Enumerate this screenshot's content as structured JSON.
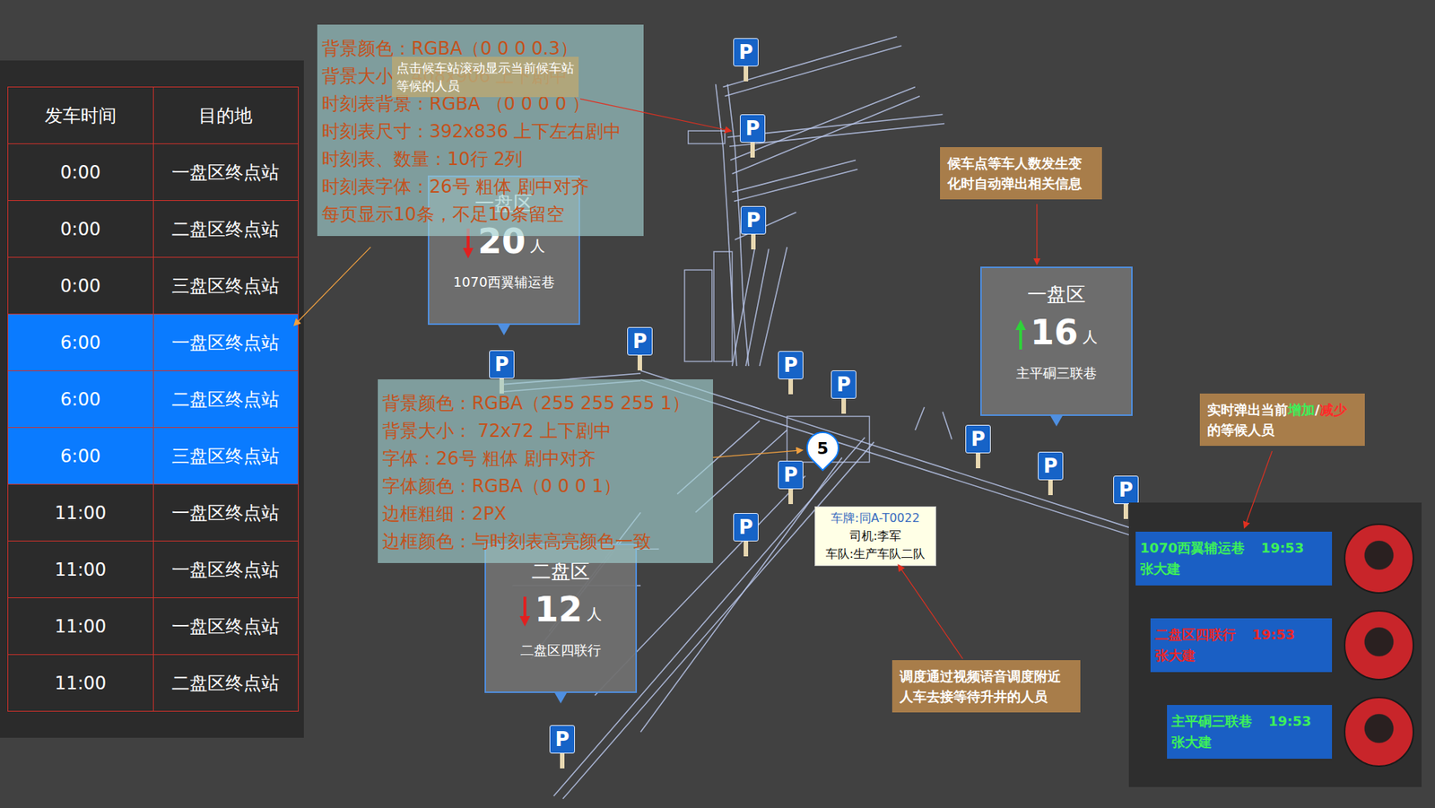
{
  "timetable": {
    "columns": [
      "发车时间",
      "目的地"
    ],
    "rows": [
      {
        "time": "0:00",
        "destination": "一盘区终点站",
        "selected": false
      },
      {
        "time": "0:00",
        "destination": "二盘区终点站",
        "selected": false
      },
      {
        "time": "0:00",
        "destination": "三盘区终点站",
        "selected": false
      },
      {
        "time": "6:00",
        "destination": "一盘区终点站",
        "selected": true
      },
      {
        "time": "6:00",
        "destination": "二盘区终点站",
        "selected": true
      },
      {
        "time": "6:00",
        "destination": "三盘区终点站",
        "selected": true
      },
      {
        "time": "11:00",
        "destination": "一盘区终点站",
        "selected": false
      },
      {
        "time": "11:00",
        "destination": "一盘区终点站",
        "selected": false
      },
      {
        "time": "11:00",
        "destination": "一盘区终点站",
        "selected": false
      },
      {
        "time": "11:00",
        "destination": "二盘区终点站",
        "selected": false
      }
    ]
  },
  "annotations": [
    {
      "lines": [
        "背景颜色：RGBA（0 0 0 0.3）",
        "背景大小：408x906 上下剧中",
        "时刻表背景：RGBA （0 0 0 0 ）",
        "时刻表尺寸：392x836 上下左右剧中",
        "时刻表、数量：10行 2列",
        "时刻表字体：26号 粗体 剧中对齐",
        "每页显示10条，不足10条留空"
      ]
    },
    {
      "lines": [
        "背景颜色：RGBA（255 255 255 1）",
        "背景大小： 72x72 上下剧中",
        "字体：26号 粗体 剧中对齐",
        "字体颜色：RGBA（0 0 0 1）",
        "边框粗细：2PX",
        "边框颜色：与时刻表高亮颜色一致"
      ]
    }
  ],
  "hint": "点击候车站滚动显示当前候车站等候的人员",
  "notes": [
    {
      "segments": [
        {
          "text": "候车点等车人数发生变化时自动弹出相关信息",
          "color": "#ffffff"
        }
      ]
    },
    {
      "segments": [
        {
          "text": "实时弹出当前",
          "color": "#ffffff"
        },
        {
          "text": "增加",
          "color": "#3cf05a"
        },
        {
          "text": "/",
          "color": "#ffffff"
        },
        {
          "text": "减少",
          "color": "#ff2a2a"
        },
        {
          "text": "的等候人员",
          "color": "#ffffff"
        }
      ]
    },
    {
      "segments": [
        {
          "text": "调度通过视频语音调度附近人车去接等待升井的人员",
          "color": "#ffffff"
        }
      ]
    }
  ],
  "stations": [
    {
      "area": "一盘区",
      "count": "20",
      "unit": "人",
      "place": "1070西翼辅运巷",
      "trend": "down",
      "color": "#e02020"
    },
    {
      "area": "一盘区",
      "count": "16",
      "unit": "人",
      "place": "主平硐三联巷",
      "trend": "up",
      "color": "#2fd13a"
    },
    {
      "area": "二盘区",
      "count": "12",
      "unit": "人",
      "place": "二盘区四联行",
      "trend": "down",
      "color": "#e02020"
    }
  ],
  "parking": [
    "P",
    "P",
    "P",
    "P",
    "P",
    "P",
    "P",
    "P",
    "P",
    "P",
    "P",
    "P",
    "P"
  ],
  "vehicle_marker": "5",
  "vehicle": {
    "lines": [
      "车牌:同A-T0022",
      "司机:李军",
      "车队:生产车队二队"
    ]
  },
  "waiting": [
    {
      "place": "1070西翼辅运巷",
      "time": "19:53",
      "name": "张大建",
      "color": "#3cf05a"
    },
    {
      "place": "二盘区四联行",
      "time": "19:53",
      "name": "张大建",
      "color": "#e8262a"
    },
    {
      "place": "主平硐三联巷",
      "time": "19:53",
      "name": "张大建",
      "color": "#3cf05a"
    }
  ]
}
